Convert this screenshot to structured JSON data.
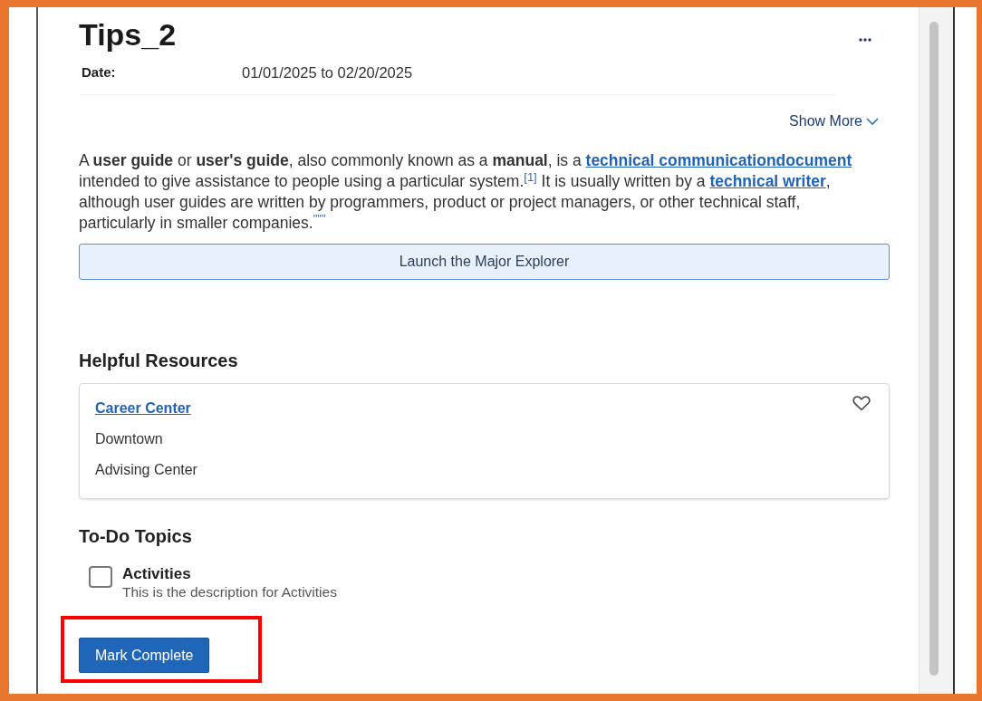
{
  "title": "Tips_2",
  "details": [
    {
      "label": "Date:",
      "value": "01/01/2025 to 02/20/2025"
    }
  ],
  "show_more": "Show More",
  "description": [
    {
      "kind": "text",
      "text": "A **user guide** or **user's guide**, also commonly known as a **manual**, is a "
    },
    {
      "kind": "link",
      "text": "technical communicationdocument"
    },
    {
      "kind": "text",
      "text": " intended to give assistance to people using a particular system.$^{[1]}$ It is usually written by a "
    },
    {
      "kind": "link",
      "text": "technical writer"
    },
    {
      "kind": "text",
      "text": ", although user guides are written by programmers, product or project managers, or other technical staff, particularly in smaller companies.$^{\"\"\"}$"
    }
  ],
  "launch_button": "Launch the Major Explorer",
  "resources": {
    "heading": "Helpful Resources",
    "items": [
      {
        "name": "Career Center",
        "lines": [
          "Downtown",
          "Advising Center"
        ],
        "favorite": false
      }
    ]
  },
  "todo": {
    "heading": "To-Do Topics",
    "items": [
      {
        "title": "Activities",
        "description": "This is the description for Activities",
        "checked": false
      }
    ]
  },
  "mark_complete": {
    "label": "Mark Complete",
    "highlighted": true
  }
}
